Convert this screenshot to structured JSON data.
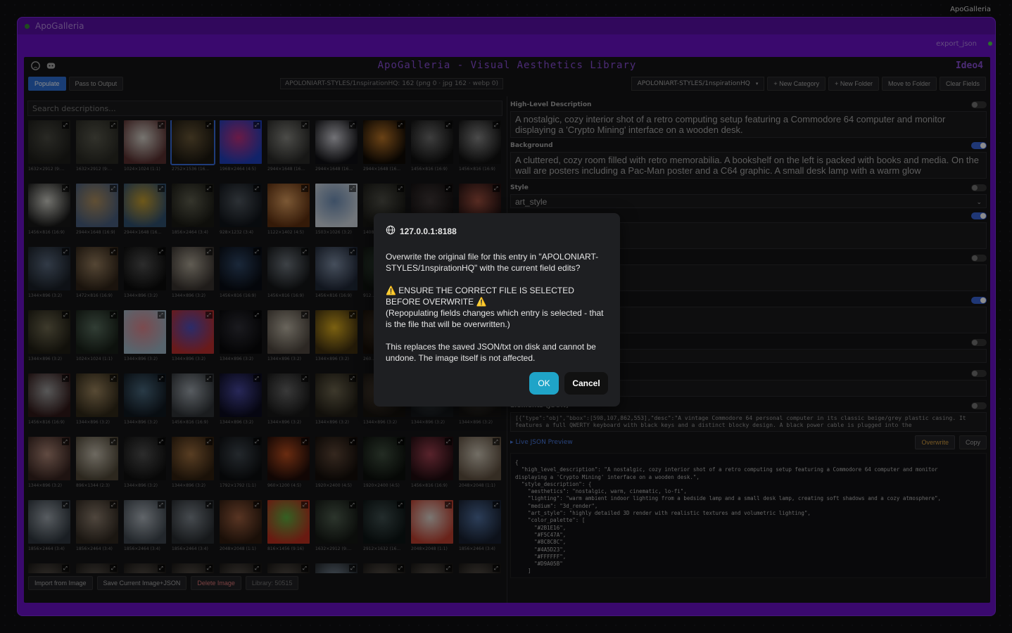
{
  "top_node_title": "ApoGalleria",
  "node": {
    "title": "ApoGalleria",
    "output_label": "export_json"
  },
  "app": {
    "title": "ApoGalleria - Visual Aesthetics Library",
    "author": "Ideo4"
  },
  "toolbar": {
    "populate": "Populate",
    "pass_output": "Pass to Output",
    "status": "APOLONIART-STYLES/1nspirationHQ: 162 (png 0 · jpg 162 · webp 0)",
    "folder_select": "APOLONIART-STYLES/1nspirationHQ",
    "new_category": "+ New Category",
    "new_folder": "+ New Folder",
    "move_folder": "Move to Folder",
    "clear_fields": "Clear Fields"
  },
  "search": {
    "placeholder": "Search descriptions..."
  },
  "thumbs": [
    {
      "cap": "1632×2912 (9:...",
      "c1": "#4a4a42",
      "c2": "#1e1e1a"
    },
    {
      "cap": "1632×2912 (9:...",
      "c1": "#5a5a4e",
      "c2": "#2a2a24"
    },
    {
      "cap": "1024×1024 (1:1)",
      "c1": "#d8d4cc",
      "c2": "#5a3030"
    },
    {
      "cap": "2752×1536 (16...",
      "c1": "#6a5838",
      "c2": "#1c1810"
    },
    {
      "cap": "1968×2464 (4:5)",
      "c1": "#c03080",
      "c2": "#2040c0"
    },
    {
      "cap": "2944×1648 (16...",
      "c1": "#8a8a84",
      "c2": "#2a2a28"
    },
    {
      "cap": "2944×1648 (16...",
      "c1": "#d0d0d8",
      "c2": "#101014"
    },
    {
      "cap": "2944×1648 (16...",
      "c1": "#c07828",
      "c2": "#100a04"
    },
    {
      "cap": "1456×816 (16:9)",
      "c1": "#707070",
      "c2": "#101010"
    },
    {
      "cap": "1456×816 (16:9)",
      "c1": "#888",
      "c2": "#111"
    },
    {
      "cap": "1456×816 (16:9)",
      "c1": "#d0d0c8",
      "c2": "#181818"
    },
    {
      "cap": "2944×1648 (16:9)",
      "c1": "#b09060",
      "c2": "#4a6080"
    },
    {
      "cap": "2944×1648 (16...",
      "c1": "#c8a030",
      "c2": "#305070"
    },
    {
      "cap": "1856×2464 (3:4)",
      "c1": "#606050",
      "c2": "#1a1a14"
    },
    {
      "cap": "928×1232 (3:4)",
      "c1": "#505860",
      "c2": "#10141a"
    },
    {
      "cap": "1122×1402 (4:5)",
      "c1": "#e0a060",
      "c2": "#603010"
    },
    {
      "cap": "1503×1026 (3:2)",
      "c1": "#7090b8",
      "c2": "#d0d8e0"
    },
    {
      "cap": "1408×...",
      "c1": "#505048",
      "c2": "#181814"
    },
    {
      "cap": "",
      "c1": "#403838",
      "c2": "#141010"
    },
    {
      "cap": "",
      "c1": "#a05040",
      "c2": "#201010"
    },
    {
      "cap": "1344×896 (3:2)",
      "c1": "#5a6a80",
      "c2": "#1a2028"
    },
    {
      "cap": "1472×816 (16:9)",
      "c1": "#9a8060",
      "c2": "#302418"
    },
    {
      "cap": "1344×896 (3:2)",
      "c1": "#505050",
      "c2": "#0c0c0c"
    },
    {
      "cap": "1344×896 (3:2)",
      "c1": "#b0a898",
      "c2": "#3a3430"
    },
    {
      "cap": "1456×816 (16:9)",
      "c1": "#304868",
      "c2": "#080c14"
    },
    {
      "cap": "1456×816 (16:9)",
      "c1": "#707880",
      "c2": "#141618"
    },
    {
      "cap": "1456×816 (16:9)",
      "c1": "#8090a8",
      "c2": "#202838"
    },
    {
      "cap": "912...",
      "c1": "#3a5040",
      "c2": "#101410"
    },
    {
      "cap": "",
      "c1": "#404040",
      "c2": "#101010"
    },
    {
      "cap": "",
      "c1": "#404040",
      "c2": "#101010"
    },
    {
      "cap": "1344×896 (3:2)",
      "c1": "#706a50",
      "c2": "#201e14"
    },
    {
      "cap": "1024×1024 (1:1)",
      "c1": "#5a7060",
      "c2": "#182018"
    },
    {
      "cap": "1344×896 (3:2)",
      "c1": "#e08890",
      "c2": "#a0b8c8"
    },
    {
      "cap": "1344×896 (3:2)",
      "c1": "#5050c0",
      "c2": "#c03030"
    },
    {
      "cap": "1344×896 (3:2)",
      "c1": "#303038",
      "c2": "#08080a"
    },
    {
      "cap": "1344×896 (3:2)",
      "c1": "#c0b8a8",
      "c2": "#504840"
    },
    {
      "cap": "1344×896 (3:2)",
      "c1": "#e0b020",
      "c2": "#403010"
    },
    {
      "cap": "260...",
      "c1": "#504030",
      "c2": "#181008"
    },
    {
      "cap": "",
      "c1": "#404040",
      "c2": "#101010"
    },
    {
      "cap": "",
      "c1": "#404040",
      "c2": "#101010"
    },
    {
      "cap": "1456×816 (16:9)",
      "c1": "#a0a0a0",
      "c2": "#301818"
    },
    {
      "cap": "1344×896 (3:2)",
      "c1": "#a08860",
      "c2": "#302818"
    },
    {
      "cap": "1344×896 (3:2)",
      "c1": "#4a6a80",
      "c2": "#101820"
    },
    {
      "cap": "1456×816 (16:9)",
      "c1": "#a0a8b0",
      "c2": "#303438"
    },
    {
      "cap": "1344×896 (3:2)",
      "c1": "#4848a0",
      "c2": "#0c0c20"
    },
    {
      "cap": "1344×896 (3:2)",
      "c1": "#686868",
      "c2": "#181818"
    },
    {
      "cap": "1344×896 (3:2)",
      "c1": "#706850",
      "c2": "#201c14"
    },
    {
      "cap": "1344×896 (3:2)",
      "c1": "#605040",
      "c2": "#181410"
    },
    {
      "cap": "1344×896 (3:2)",
      "c1": "#606870",
      "c2": "#181c20"
    },
    {
      "cap": "1344×896 (3:2)",
      "c1": "#605850",
      "c2": "#181614"
    },
    {
      "cap": "1344×896 (3:2)",
      "c1": "#b08878",
      "c2": "#382420"
    },
    {
      "cap": "896×1344 (2:3)",
      "c1": "#c8c0b0",
      "c2": "#504838"
    },
    {
      "cap": "1344×896 (3:2)",
      "c1": "#505050",
      "c2": "#101010"
    },
    {
      "cap": "1344×896 (3:2)",
      "c1": "#a07040",
      "c2": "#302010"
    },
    {
      "cap": "1792×1792 (1:1)",
      "c1": "#404850",
      "c2": "#0c0e10"
    },
    {
      "cap": "960×1200 (4:5)",
      "c1": "#c05020",
      "c2": "#200c08"
    },
    {
      "cap": "1920×2400 (4:5)",
      "c1": "#604838",
      "c2": "#140e0a"
    },
    {
      "cap": "1920×2400 (4:5)",
      "c1": "#405040",
      "c2": "#0c100c"
    },
    {
      "cap": "1456×816 (16:9)",
      "c1": "#a04050",
      "c2": "#200c10"
    },
    {
      "cap": "2048×2048 (1:1)",
      "c1": "#d0c8b8",
      "c2": "#605040"
    },
    {
      "cap": "1856×2464 (3:4)",
      "c1": "#a0a8b0",
      "c2": "#303840"
    },
    {
      "cap": "1856×2464 (3:4)",
      "c1": "#908070",
      "c2": "#302820"
    },
    {
      "cap": "1856×2464 (3:4)",
      "c1": "#b0b8c0",
      "c2": "#404850"
    },
    {
      "cap": "1856×2464 (3:4)",
      "c1": "#808890",
      "c2": "#282c30"
    },
    {
      "cap": "2048×2048 (1:1)",
      "c1": "#a06040",
      "c2": "#301c10"
    },
    {
      "cap": "816×1456 (9:16)",
      "c1": "#60b040",
      "c2": "#c03020"
    },
    {
      "cap": "1632×2912 (9:...",
      "c1": "#506050",
      "c2": "#141814"
    },
    {
      "cap": "2912×1632 (16...",
      "c1": "#405050",
      "c2": "#0c1414"
    },
    {
      "cap": "2048×2048 (1:1)",
      "c1": "#e0d8d0",
      "c2": "#c04030"
    },
    {
      "cap": "1856×2464 (3:4)",
      "c1": "#5070a0",
      "c2": "#182030"
    },
    {
      "cap": "",
      "c1": "#605850",
      "c2": "#181614"
    },
    {
      "cap": "",
      "c1": "#605850",
      "c2": "#181614"
    },
    {
      "cap": "",
      "c1": "#605850",
      "c2": "#181614"
    },
    {
      "cap": "",
      "c1": "#605850",
      "c2": "#181614"
    },
    {
      "cap": "",
      "c1": "#605850",
      "c2": "#181614"
    },
    {
      "cap": "",
      "c1": "#605850",
      "c2": "#181614"
    },
    {
      "cap": "",
      "c1": "#8090a0",
      "c2": "#202428"
    },
    {
      "cap": "",
      "c1": "#605850",
      "c2": "#181614"
    },
    {
      "cap": "",
      "c1": "#605850",
      "c2": "#181614"
    },
    {
      "cap": "",
      "c1": "#605850",
      "c2": "#181614"
    }
  ],
  "bottom": {
    "import": "Import from Image",
    "save": "Save Current Image+JSON",
    "delete": "Delete Image",
    "library": "Library: 50515"
  },
  "fields": {
    "high_level": {
      "label": "High-Level Description",
      "value": "A nostalgic, cozy interior shot of a retro computing setup featuring a Commodore 64 computer and monitor displaying a 'Crypto Mining' interface on a wooden desk."
    },
    "background": {
      "label": "Background",
      "value": "A cluttered, cozy room filled with retro memorabilia. A bookshelf on the left is packed with books and media. On the wall are posters including a Pac-Man poster and a C64 graphic. A small desk lamp with a warm glow"
    },
    "style": {
      "label": "Style",
      "value": "art_style"
    },
    "art_style_value": "r with realistic textures and volumetric lighting",
    "aesthetics_value": "tic, lo-fi",
    "lighting_value": "nting from a bedside lamp and a small desk lamp, creating soft shadows and a cozy",
    "palette_value": "\"#4A5D23\",\"#FFFFFF\",\"#D9A05B\"]",
    "elements": {
      "label": "Elements (JSON)",
      "value": "[{\"type\":\"obj\",\"bbox\":[598,107,862,553],\"desc\":\"A vintage Commodore 64 personal computer in its classic beige/grey plastic casing. It features a full QWERTY keyboard with black keys and a distinct blocky design. A black power cable is plugged into the"
    }
  },
  "preview": {
    "link": "▸ Live JSON Preview",
    "overwrite": "Overwrite",
    "copy": "Copy",
    "json": "{\n  \"high_level_description\": \"A nostalgic, cozy interior shot of a retro computing setup featuring a Commodore 64 computer and monitor\ndisplaying a 'Crypto Mining' interface on a wooden desk.\",\n  \"style_description\": {\n    \"aesthetics\": \"nostalgic, warm, cinematic, lo-fi\",\n    \"lighting\": \"warm ambient indoor lighting from a bedside lamp and a small desk lamp, creating soft shadows and a cozy atmosphere\",\n    \"medium\": \"3d_render\",\n    \"art_style\": \"highly detailed 3D render with realistic textures and volumetric lighting\",\n    \"color_palette\": [\n      \"#2B1E16\",\n      \"#F5C47A\",\n      \"#8C8C8C\",\n      \"#4A5D23\",\n      \"#FFFFFF\",\n      \"#D9A05B\"\n    ]"
  },
  "dialog": {
    "host": "127.0.0.1:8188",
    "line1": "Overwrite the original file for this entry in \"APOLONIART-STYLES/1nspirationHQ\" with the current field edits?",
    "warning": "⚠️ ENSURE THE CORRECT FILE IS SELECTED BEFORE OVERWRITE ⚠️",
    "warning_note": "(Repopulating fields changes which entry is selected - that is the file that will be overwritten.)",
    "line3": "This replaces the saved JSON/txt on disk and cannot be undone. The image itself is not affected.",
    "ok": "OK",
    "cancel": "Cancel"
  }
}
